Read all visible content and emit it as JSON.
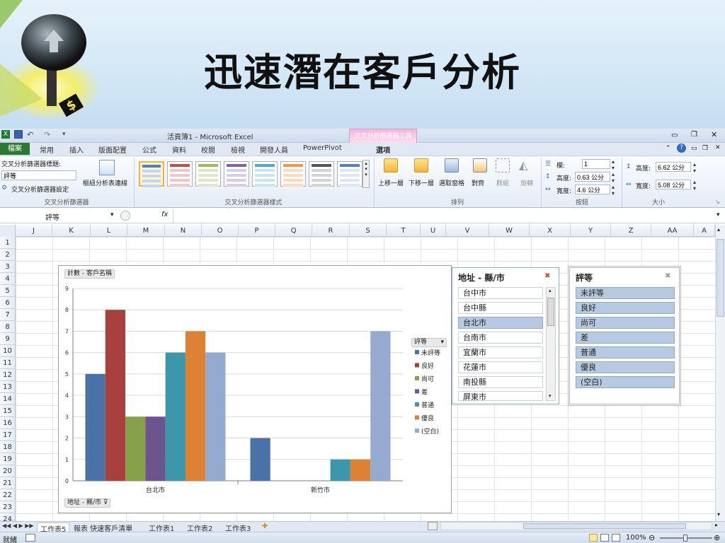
{
  "slide": {
    "title": "迅速潛在客戶分析"
  },
  "window": {
    "title": "活頁簿1 - Microsoft Excel",
    "context_tab_title": "交叉分析篩選器工具"
  },
  "tabs": [
    "檔案",
    "常用",
    "插入",
    "版面配置",
    "公式",
    "資料",
    "校閱",
    "檢視",
    "開發人員",
    "PowerPivot",
    "選項"
  ],
  "ribbon": {
    "caption_label": "交叉分析篩選器標題:",
    "caption_value": "評等",
    "settings_label": "交叉分析篩選器設定",
    "pivot_conn_label": "樞紐分析表連線",
    "group_slicer": "交叉分析篩選器",
    "group_styles": "交叉分析篩選器樣式",
    "bring_forward": "上移一層",
    "send_backward": "下移一層",
    "selection_pane": "選取窗格",
    "align": "對齊",
    "group_btn": "群組",
    "rotate": "旋轉",
    "group_arrange": "排列",
    "columns_label": "欄:",
    "columns_value": "1",
    "btn_height_label": "高度:",
    "btn_height_value": "0.63 公分",
    "btn_width_label": "寬度:",
    "btn_width_value": "4.6 公分",
    "group_buttons": "按鈕",
    "size_height_label": "高度:",
    "size_height_value": "6.62 公分",
    "size_width_label": "寬度:",
    "size_width_value": "5.08 公分",
    "group_size": "大小"
  },
  "formula_bar": {
    "name_box": "評等",
    "fx": "fx",
    "formula": ""
  },
  "columns": [
    "J",
    "K",
    "L",
    "M",
    "N",
    "O",
    "P",
    "Q",
    "R",
    "S",
    "T",
    "U",
    "V",
    "W",
    "X",
    "Y",
    "Z",
    "AA",
    "A"
  ],
  "rows": [
    "1",
    "2",
    "3",
    "4",
    "5",
    "6",
    "7",
    "8",
    "9",
    "10",
    "11",
    "12",
    "13",
    "14",
    "15",
    "16",
    "17",
    "18",
    "19",
    "20",
    "21",
    "22",
    "23",
    "24"
  ],
  "chart_data": {
    "type": "bar",
    "value_field": "計數 - 客戶名稱",
    "axis_field": "地址 - 縣/市",
    "legend_field": "評等",
    "categories": [
      "台北市",
      "新竹市"
    ],
    "ylim": [
      0,
      9
    ],
    "yticks": [
      "0",
      "1",
      "2",
      "3",
      "4",
      "5",
      "6",
      "7",
      "8",
      "9"
    ],
    "grid": true,
    "legend_position": "right",
    "series": [
      {
        "name": "未評等",
        "color": "#4a72a8",
        "values": [
          5,
          2
        ]
      },
      {
        "name": "良好",
        "color": "#a8403e",
        "values": [
          8,
          0
        ]
      },
      {
        "name": "尚可",
        "color": "#87a04a",
        "values": [
          3,
          0
        ]
      },
      {
        "name": "差",
        "color": "#6d548f",
        "values": [
          3,
          0
        ]
      },
      {
        "name": "普通",
        "color": "#3c97aa",
        "values": [
          6,
          1
        ]
      },
      {
        "name": "優良",
        "color": "#dd8135",
        "values": [
          7,
          1
        ]
      },
      {
        "name": "(空白)",
        "color": "#94aacf",
        "values": [
          6,
          7
        ]
      }
    ]
  },
  "slicer_city": {
    "title": "地址 - 縣/市",
    "items": [
      {
        "label": "台中市",
        "selected": false
      },
      {
        "label": "台中縣",
        "selected": false
      },
      {
        "label": "台北市",
        "selected": true
      },
      {
        "label": "台南市",
        "selected": false
      },
      {
        "label": "宜蘭市",
        "selected": false
      },
      {
        "label": "花蓮市",
        "selected": false
      },
      {
        "label": "南投縣",
        "selected": false
      },
      {
        "label": "屏東市",
        "selected": false
      }
    ]
  },
  "slicer_rating": {
    "title": "評等",
    "items": [
      {
        "label": "未評等",
        "selected": true
      },
      {
        "label": "良好",
        "selected": true
      },
      {
        "label": "尚可",
        "selected": true
      },
      {
        "label": "差",
        "selected": true
      },
      {
        "label": "普通",
        "selected": true
      },
      {
        "label": "優良",
        "selected": true
      },
      {
        "label": "(空白)",
        "selected": true
      }
    ]
  },
  "sheet_tabs": [
    "工作表5",
    "報表 快速客戶清單",
    "工作表1",
    "工作表2",
    "工作表3"
  ],
  "status": {
    "ready": "就緒",
    "zoom": "100%"
  },
  "colors": {
    "file_tab": "#2c7a32",
    "context_tab": "#f6b5dc",
    "selected_item": "#b6cbe2"
  }
}
